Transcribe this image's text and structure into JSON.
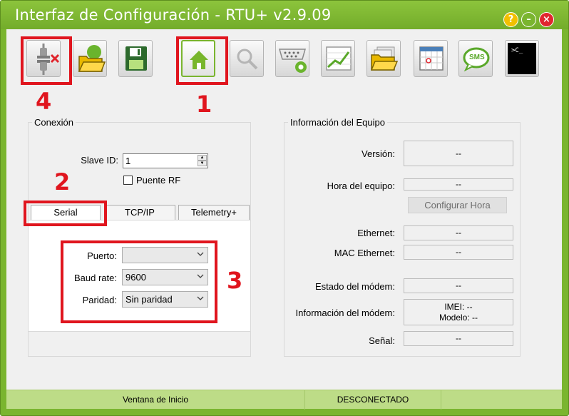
{
  "window": {
    "title": "Interfaz de Configuración - RTU+ v2.9.09",
    "help_glyph": "?",
    "min_glyph": "–",
    "close_glyph": "×"
  },
  "toolbar": {
    "items": [
      {
        "name": "disconnect-icon"
      },
      {
        "name": "open-folder-icon"
      },
      {
        "name": "save-icon"
      },
      {
        "name": "home-icon"
      },
      {
        "name": "search-icon"
      },
      {
        "name": "serial-port-settings-icon"
      },
      {
        "name": "chart-icon"
      },
      {
        "name": "folders-icon"
      },
      {
        "name": "calendar-icon"
      },
      {
        "name": "sms-icon"
      },
      {
        "name": "terminal-icon"
      }
    ],
    "terminal_prompt": ">C_",
    "sms_label": "SMS"
  },
  "annotations": {
    "n1": "1",
    "n2": "2",
    "n3": "3",
    "n4": "4",
    "color": "#e0151e"
  },
  "connection": {
    "title": "Conexión",
    "slave_id_label": "Slave ID:",
    "slave_id_value": "1",
    "rf_bridge_label": "Puente RF",
    "rf_bridge_checked": false,
    "tabs": [
      {
        "label": "Serial",
        "active": true
      },
      {
        "label": "TCP/IP",
        "active": false
      },
      {
        "label": "Telemetry+",
        "active": false
      }
    ],
    "serial": {
      "port_label": "Puerto:",
      "port_value": "",
      "baud_label": "Baud rate:",
      "baud_value": "9600",
      "parity_label": "Paridad:",
      "parity_value": "Sin paridad"
    }
  },
  "device_info": {
    "title": "Información del Equipo",
    "version_label": "Versión:",
    "version_value": "--",
    "time_label": "Hora del equipo:",
    "time_value": "--",
    "set_time_button": "Configurar Hora",
    "ethernet_label": "Ethernet:",
    "ethernet_value": "--",
    "mac_label": "MAC Ethernet:",
    "mac_value": "--",
    "modem_state_label": "Estado del módem:",
    "modem_state_value": "--",
    "modem_info_label": "Información del módem:",
    "modem_imei": "IMEI: --",
    "modem_model": "Modelo: --",
    "signal_label": "Señal:",
    "signal_value": "--"
  },
  "status_bar": {
    "view": "Ventana de Inicio",
    "connection_state": "DESCONECTADO",
    "extra": ""
  },
  "colors": {
    "accent_green": "#7ab52f",
    "status_green": "#bddc87",
    "close_red": "#e0262e",
    "help_yellow": "#f2c000"
  }
}
